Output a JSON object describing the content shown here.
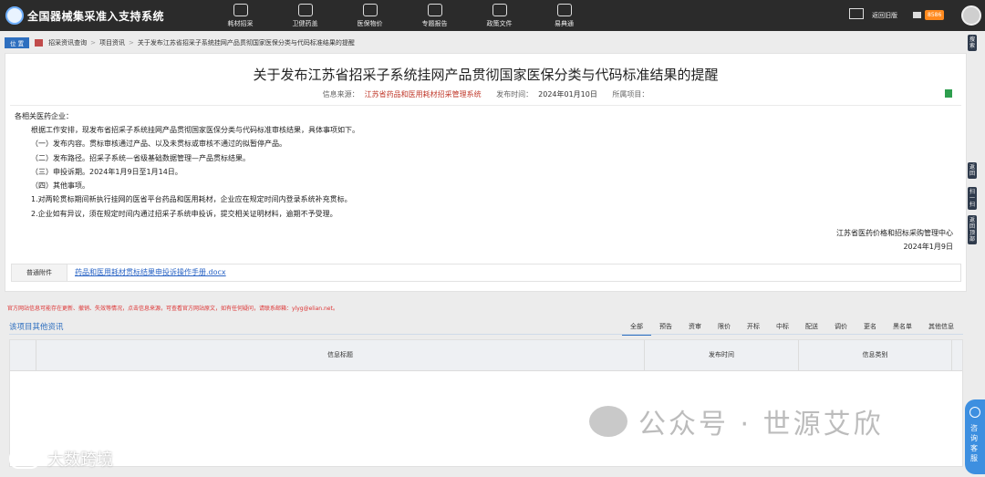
{
  "header": {
    "app_title": "全国器械集采准入支持系统",
    "nav": [
      {
        "label": "耗材招采",
        "icon": "cart-icon"
      },
      {
        "label": "卫健药盖",
        "icon": "cloud-icon"
      },
      {
        "label": "医保物价",
        "icon": "medical-icon"
      },
      {
        "label": "专题报告",
        "icon": "report-icon"
      },
      {
        "label": "政策文件",
        "icon": "document-icon"
      },
      {
        "label": "易典通",
        "icon": "search-book-icon"
      }
    ],
    "back_old": "返回旧版",
    "badge": "8586"
  },
  "breadcrumb": {
    "tag": "位 置",
    "items": [
      "招采资讯查询",
      "项目资讯",
      "关于发布江苏省招采子系统挂网产品贯彻国家医保分类与代码标准结果的提醒"
    ]
  },
  "article": {
    "title": "关于发布江苏省招采子系统挂网产品贯彻国家医保分类与代码标准结果的提醒",
    "source_label": "信息来源：",
    "source": "江苏省药品和医用耗材招采管理系统",
    "time_label": "发布时间：",
    "time": "2024年01月10日",
    "project_label": "所属项目：",
    "lines": [
      "各相关医药企业：",
      "根据工作安排，现发布省招采子系统挂网产品贯彻国家医保分类与代码标准审核结果，具体事项如下。",
      "（一）发布内容。贯标审核通过产品、以及未贯标或审核不通过的拟暂停产品。",
      "（二）发布路径。招采子系统—省级基础数据管理—产品贯标结果。",
      "（三）申投诉期。2024年1月9日至1月14日。",
      "（四）其他事项。",
      "1.对两轮贯标期间新执行挂网的医省平台药品和医用耗材，企业应在规定时间内登录系统补充贯标。",
      "2.企业如有异议，须在规定时间内通过招采子系统申投诉，提交相关证明材料，逾期不予受理。"
    ],
    "signature": "江苏省医药价格和招标采购管理中心",
    "sign_date": "2024年1月9日",
    "attach_label": "普通附件",
    "attach_file": "药品和医用耗材贯标结果申投诉操作手册.docx"
  },
  "disclaimer": "官方网站信息可能存在更新、撤销、失效等情况，点击信息来源，可查看官方网站原文，如有任何疑问，请联系邮箱：ylyg@elian.net。",
  "related": {
    "title": "该项目其他资讯",
    "tabs": [
      "全部",
      "预告",
      "资审",
      "限价",
      "开标",
      "中标",
      "配送",
      "调价",
      "更名",
      "黑名单",
      "其他信息"
    ],
    "active_tab": 0,
    "columns": [
      "信息标题",
      "发布时间",
      "信息类别"
    ]
  },
  "side": {
    "top_btn": "搜索",
    "btns": [
      "返回",
      "扫一扫",
      "返回顶部"
    ],
    "consult": "咨询客服"
  },
  "watermark": {
    "right": "公众号 · 世源艾欣",
    "left": "大数跨境"
  }
}
